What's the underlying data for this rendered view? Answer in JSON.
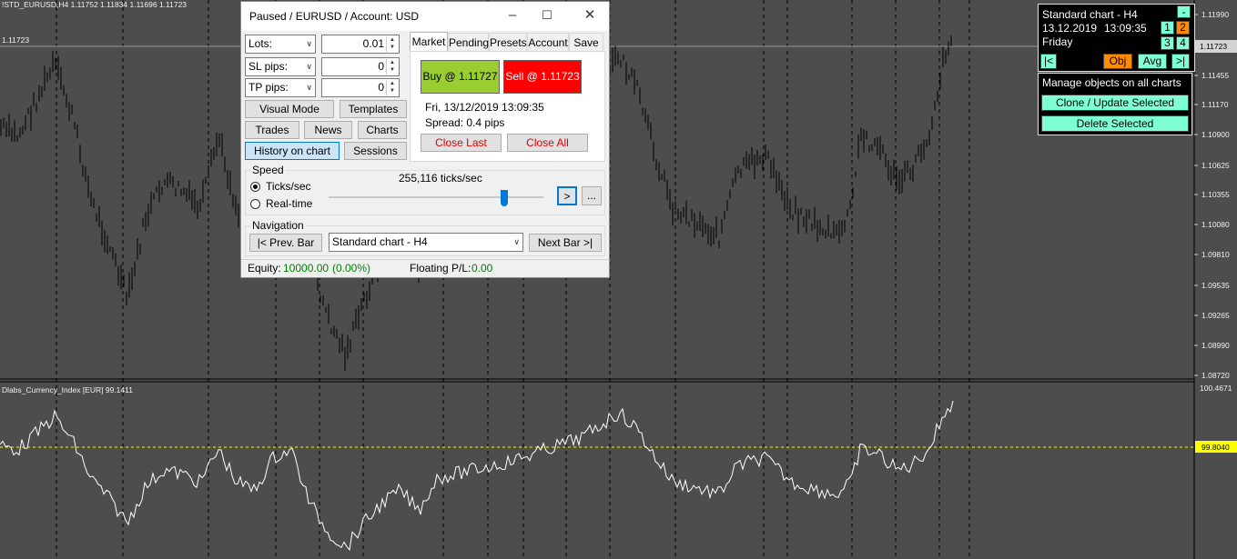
{
  "chart": {
    "symbol_label": "!STD_EURUSD,H4  1.11752 1.11834 1.11696 1.11723",
    "current_price_left": "1.11723",
    "current_price_tag": "1.11723",
    "price_axis": [
      "1.11990",
      "1.11455",
      "1.11170",
      "1.10900",
      "1.10625",
      "1.10355",
      "1.10080",
      "1.09810",
      "1.09535",
      "1.09265",
      "1.08990",
      "1.08720"
    ],
    "indicator_label": "Dlabs_Currency_Index [EUR] 99.1411",
    "indicator_top": "100.4671",
    "indicator_level_tag": "99.8040",
    "colors": {
      "background": "#4d4d4d",
      "candles": "#000000",
      "indicator_line": "#ffffff",
      "level_line": "#ffff00",
      "grid": "#000000"
    }
  },
  "dialog": {
    "title": "Paused / EURUSD / Account: USD",
    "lots_label": "Lots:",
    "lots_value": "0.01",
    "sl_label": "SL pips:",
    "sl_value": "0",
    "tp_label": "TP pips:",
    "tp_value": "0",
    "buttons": {
      "visual_mode": "Visual Mode",
      "templates": "Templates",
      "trades": "Trades",
      "news": "News",
      "charts": "Charts",
      "history_on_chart": "History on chart",
      "sessions": "Sessions"
    },
    "tabs": [
      "Market",
      "Pending",
      "Presets",
      "Account",
      "Save"
    ],
    "market": {
      "buy": "Buy @ 1.11727",
      "sell": "Sell @ 1.11723",
      "datetime": "Fri, 13/12/2019  13:09:35",
      "spread": "Spread: 0.4 pips",
      "close_last": "Close Last",
      "close_all": "Close All"
    },
    "speed": {
      "group_label": "Speed",
      "ticks_option": "Ticks/sec",
      "realtime_option": "Real-time",
      "rate": "255,116 ticks/sec",
      "play": ">",
      "more": "..."
    },
    "navigation": {
      "group_label": "Navigation",
      "prev": "|< Prev. Bar",
      "chart_select": "Standard chart - H4",
      "next": "Next Bar >|"
    },
    "status": {
      "equity_label": "Equity:",
      "equity_value": "10000.00",
      "equity_pct": "(0.00%)",
      "floating_label": "Floating P/L:",
      "floating_value": "0.00"
    }
  },
  "overlay": {
    "title": "Standard chart - H4",
    "minimize": "-",
    "date": "13.12.2019",
    "time": "13:09:35",
    "day": "Friday",
    "slots": [
      "1",
      "2",
      "3",
      "4"
    ],
    "first": "|<",
    "obj": "Obj",
    "avg": "Avg",
    "last": ">|"
  },
  "manager": {
    "title": "Manage objects on all charts",
    "clone": "Clone / Update Selected",
    "delete": "Delete Selected"
  }
}
